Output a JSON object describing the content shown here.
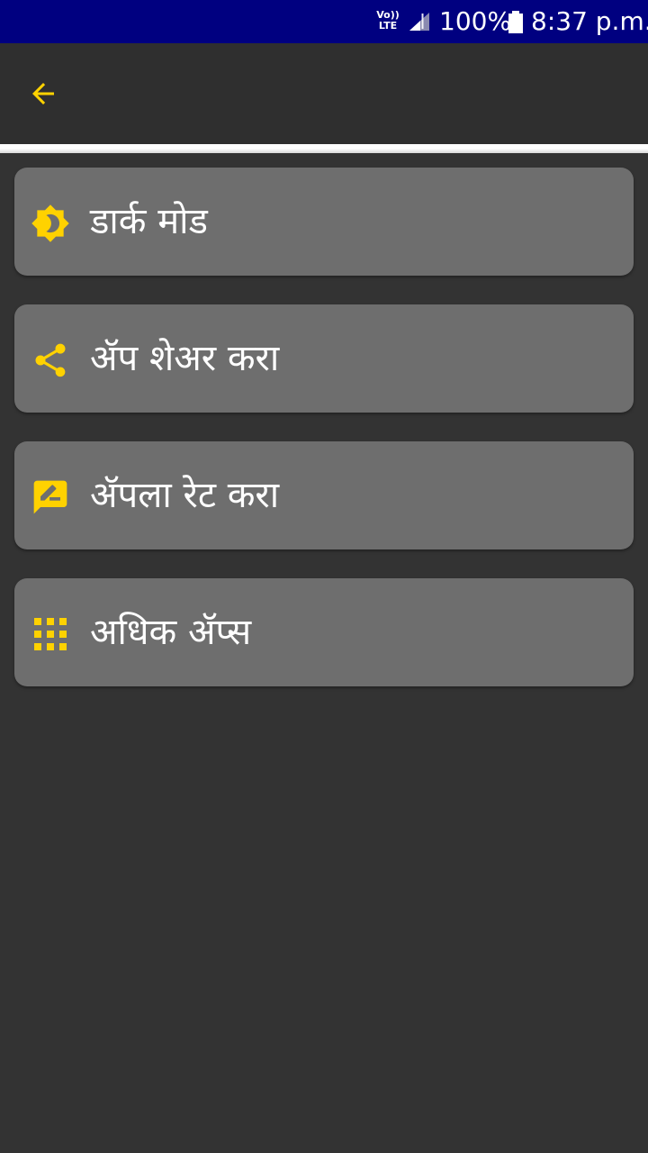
{
  "status_bar": {
    "volte_line1": "Vo))",
    "volte_line2": "LTE",
    "battery_percent": "100%",
    "time": "8:37 p.m."
  },
  "app_bar": {
    "back_icon": "arrow-back-icon"
  },
  "colors": {
    "accent": "#ffd200",
    "status_bar": "#000080",
    "background": "#333333",
    "card": "#6e6e6e"
  },
  "menu": {
    "items": [
      {
        "label": "डार्क मोड",
        "icon": "brightness-icon"
      },
      {
        "label": "ॲप शेअर करा",
        "icon": "share-icon"
      },
      {
        "label": "ॲपला रेट करा",
        "icon": "rate-review-icon"
      },
      {
        "label": "अधिक ॲप्स",
        "icon": "apps-grid-icon"
      }
    ]
  }
}
